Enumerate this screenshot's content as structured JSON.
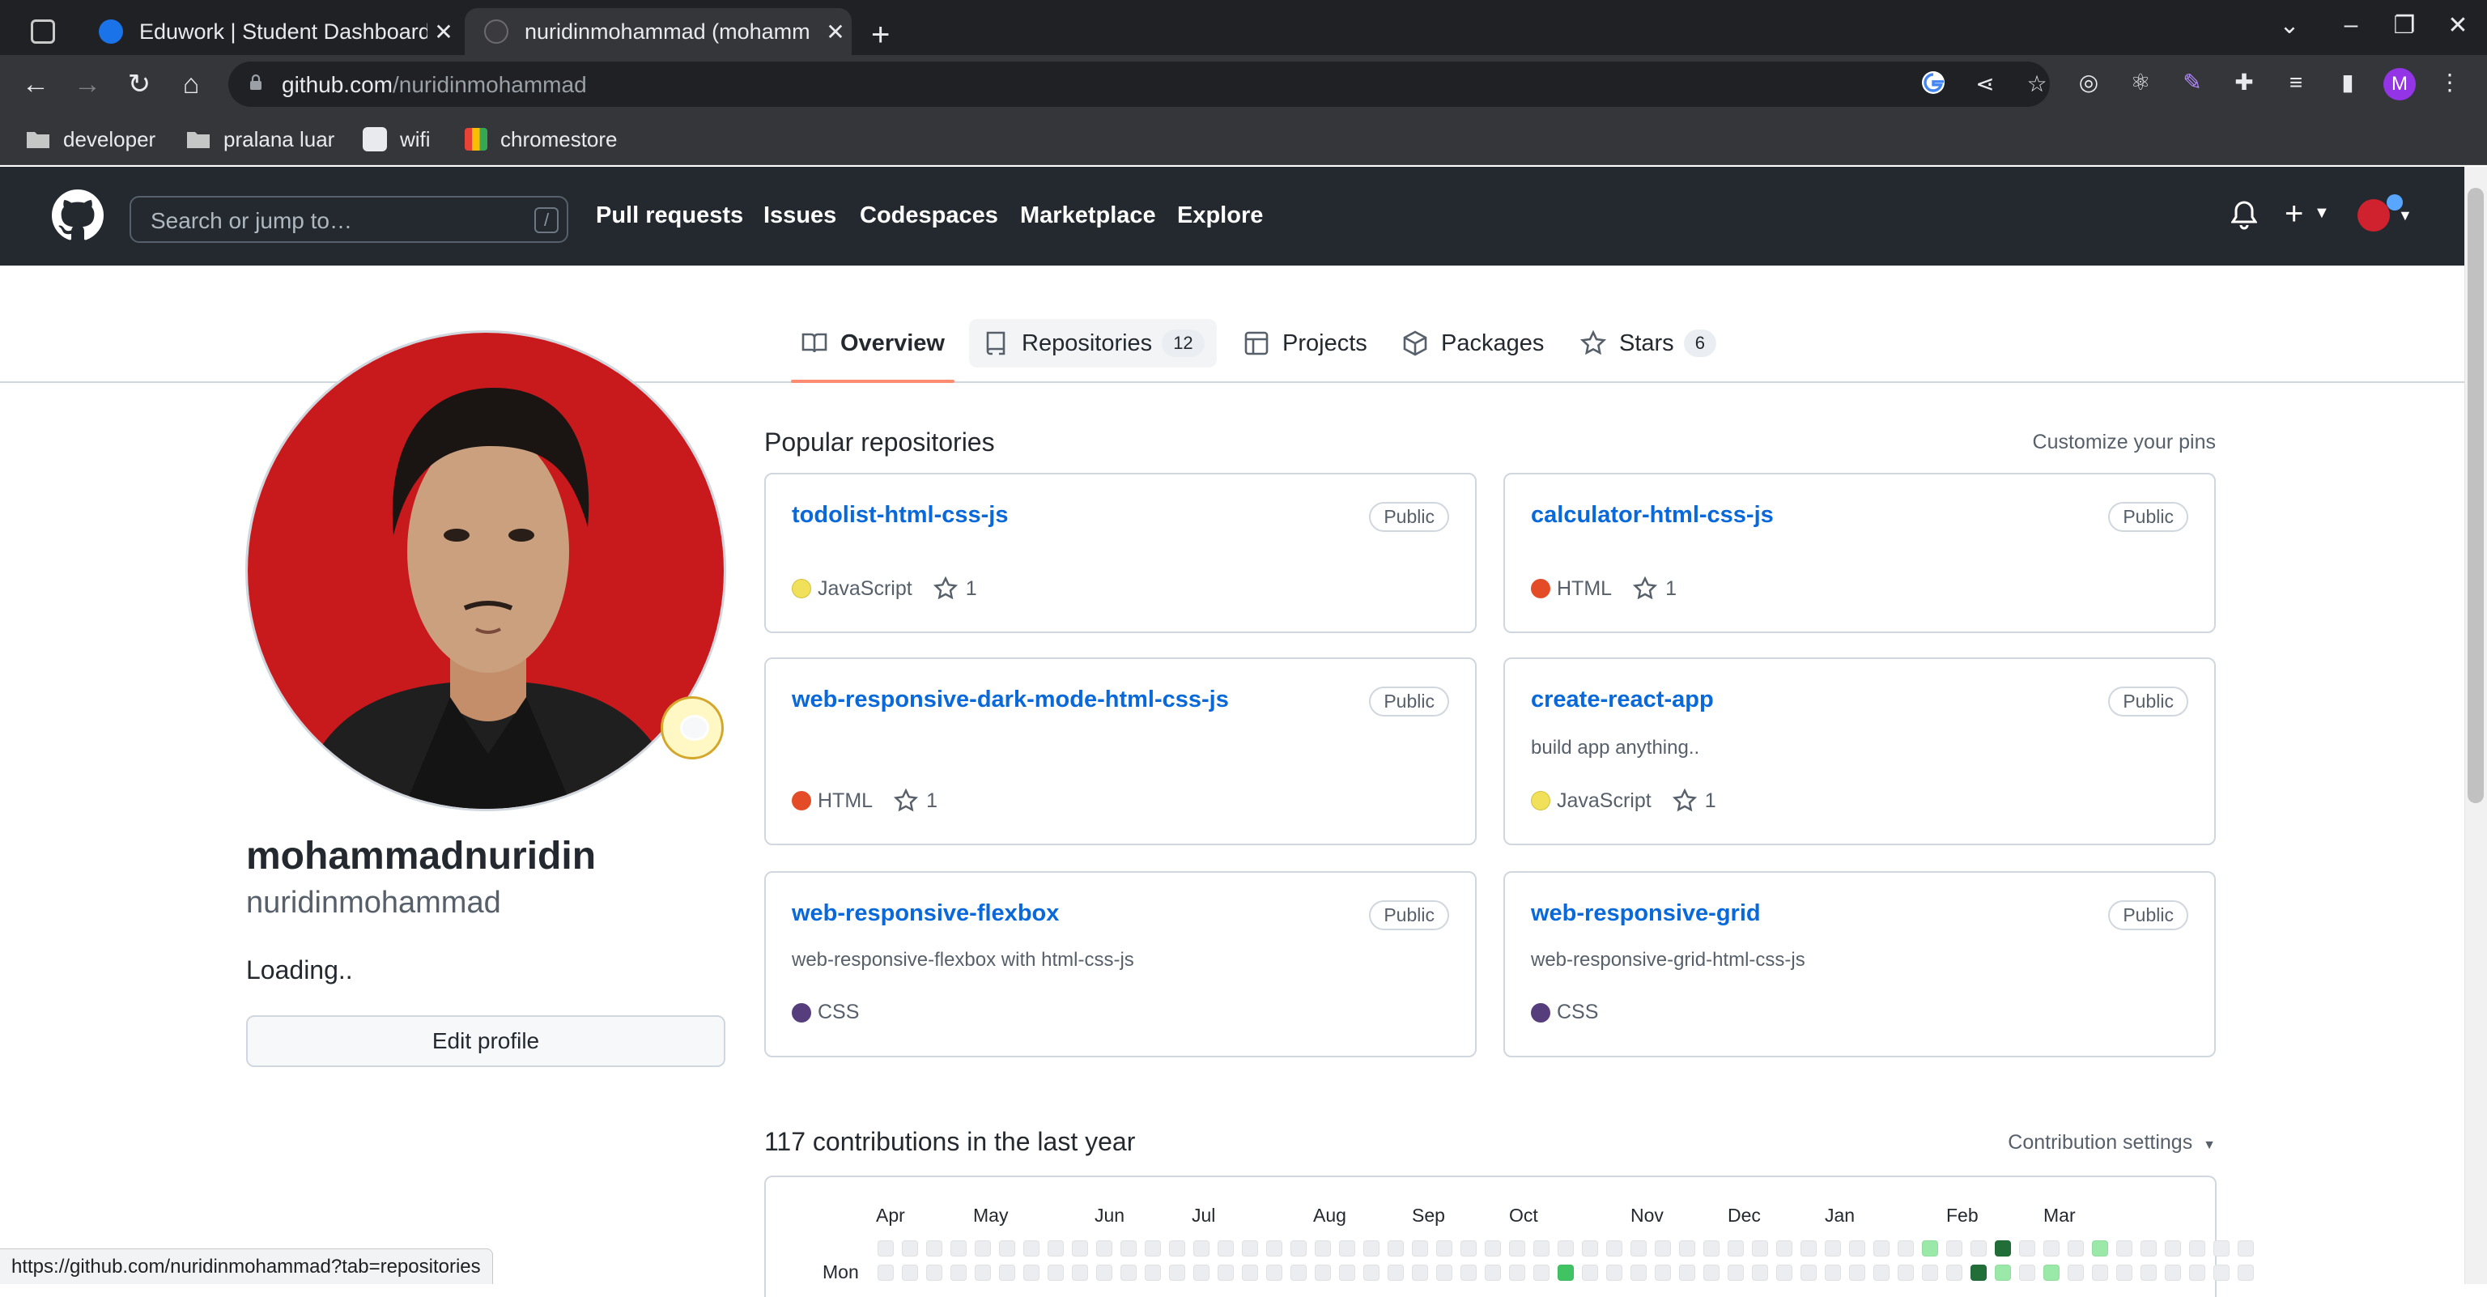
{
  "browser": {
    "tabs": [
      {
        "title": "",
        "icon": "chatgpt-icon"
      },
      {
        "title": "Eduwork | Student Dashboard",
        "icon": "eduwork-icon"
      },
      {
        "title": "nuridinmohammad (mohamm",
        "icon": "github-icon"
      }
    ],
    "url_host": "github.com",
    "url_path": "/nuridinmohammad",
    "profile_initial": "M",
    "bookmarks": [
      "developer",
      "pralana luar",
      "wifi",
      "chromestore"
    ],
    "status_url": "https://github.com/nuridinmohammad?tab=repositories"
  },
  "header": {
    "search_placeholder": "Search or jump to…",
    "search_shortcut": "/",
    "nav": [
      "Pull requests",
      "Issues",
      "Codespaces",
      "Marketplace",
      "Explore"
    ]
  },
  "profile_tabs": {
    "overview": "Overview",
    "repositories": "Repositories",
    "repositories_count": "12",
    "projects": "Projects",
    "packages": "Packages",
    "stars": "Stars",
    "stars_count": "6"
  },
  "profile": {
    "fullname": "mohammadnuridin",
    "username": "nuridinmohammad",
    "bio": "Loading..",
    "edit_button": "Edit profile"
  },
  "popular": {
    "title": "Popular repositories",
    "customize": "Customize your pins",
    "repos": [
      {
        "name": "todolist-html-css-js",
        "visibility": "Public",
        "description": "",
        "language": "JavaScript",
        "lang_color": "#f1e05a",
        "stars": "1"
      },
      {
        "name": "calculator-html-css-js",
        "visibility": "Public",
        "description": "",
        "language": "HTML",
        "lang_color": "#e34c26",
        "stars": "1"
      },
      {
        "name": "web-responsive-dark-mode-html-css-js",
        "visibility": "Public",
        "description": "",
        "language": "HTML",
        "lang_color": "#e34c26",
        "stars": "1"
      },
      {
        "name": "create-react-app",
        "visibility": "Public",
        "description": "build app anything..",
        "language": "JavaScript",
        "lang_color": "#f1e05a",
        "stars": "1"
      },
      {
        "name": "web-responsive-flexbox",
        "visibility": "Public",
        "description": "web-responsive-flexbox with html-css-js",
        "language": "CSS",
        "lang_color": "#563d7c",
        "stars": ""
      },
      {
        "name": "web-responsive-grid",
        "visibility": "Public",
        "description": "web-responsive-grid-html-css-js",
        "language": "CSS",
        "lang_color": "#563d7c",
        "stars": ""
      }
    ]
  },
  "contributions": {
    "title": "117 contributions in the last year",
    "settings": "Contribution settings",
    "months": [
      "Apr",
      "May",
      "Jun",
      "Jul",
      "Aug",
      "Sep",
      "Oct",
      "Nov",
      "Dec",
      "Jan",
      "Feb",
      "Mar"
    ],
    "day_label": "Mon",
    "colors": {
      "0": "#ebedf0",
      "1": "#9be9a8",
      "2": "#40c463",
      "3": "#30a14e",
      "4": "#216e39"
    },
    "row0_levels": [
      0,
      0,
      0,
      0,
      0,
      0,
      0,
      0,
      0,
      0,
      0,
      0,
      0,
      0,
      0,
      0,
      0,
      0,
      0,
      0,
      0,
      0,
      0,
      0,
      0,
      0,
      0,
      0,
      0,
      0,
      0,
      0,
      0,
      0,
      0,
      0,
      0,
      0,
      0,
      0,
      0,
      0,
      0,
      1,
      0,
      0,
      4,
      0,
      0,
      0,
      1,
      0,
      0,
      0,
      0,
      0,
      0
    ],
    "row1_levels": [
      0,
      0,
      0,
      0,
      0,
      0,
      0,
      0,
      0,
      0,
      0,
      0,
      0,
      0,
      0,
      0,
      0,
      0,
      0,
      0,
      0,
      0,
      0,
      0,
      0,
      0,
      0,
      0,
      2,
      0,
      0,
      0,
      0,
      0,
      0,
      0,
      0,
      0,
      0,
      0,
      0,
      0,
      0,
      0,
      0,
      4,
      1,
      0,
      1,
      0,
      0,
      0,
      0,
      0,
      0,
      0,
      0
    ]
  }
}
